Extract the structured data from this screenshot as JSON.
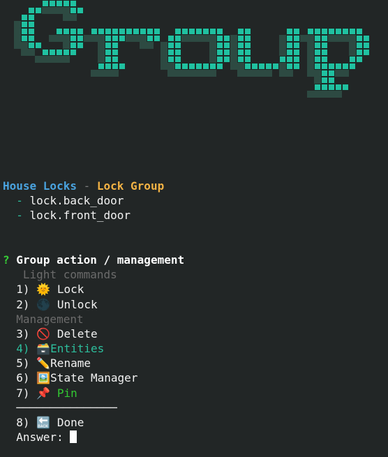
{
  "banner": {
    "text": "Group",
    "fill_color": "#20c1a1",
    "shadow_color": "#2d4a42",
    "grid_line_color": "#1c2a26"
  },
  "header": {
    "breadcrumb_parent": "House Locks",
    "breadcrumb_separator": " - ",
    "breadcrumb_current": "Lock Group",
    "members": [
      "lock.back_door",
      "lock.front_door"
    ],
    "member_bullet": "-"
  },
  "prompt": {
    "marker": "?",
    "question": "Group action / management",
    "sections": [
      {
        "heading": "Light commands",
        "options": [
          {
            "number": "1)",
            "icon": "sun-icon",
            "glyph": "🌞",
            "label": "Lock",
            "style": "normal"
          },
          {
            "number": "2)",
            "icon": "new-moon-icon",
            "glyph": "🌑",
            "label": "Unlock",
            "style": "normal"
          }
        ]
      },
      {
        "heading": "Management",
        "options": [
          {
            "number": "3)",
            "icon": "prohibited-icon",
            "glyph": "🚫",
            "label": "Delete",
            "style": "normal"
          },
          {
            "number": "4)",
            "icon": "card-file-box-icon",
            "glyph": "🗃️",
            "label": "Entities",
            "style": "selected"
          },
          {
            "number": "5)",
            "icon": "pencil-icon",
            "glyph": "✏️",
            "label": "Rename",
            "style": "normal"
          },
          {
            "number": "6)",
            "icon": "framed-picture-icon",
            "glyph": "🖼️",
            "label": "State Manager",
            "style": "normal"
          },
          {
            "number": "7)",
            "icon": "pushpin-icon",
            "glyph": "📌",
            "label": "Pin",
            "style": "accent"
          }
        ]
      }
    ],
    "separator": "───────────────",
    "done_option": {
      "number": "8)",
      "icon": "back-arrow-icon",
      "glyph": "🔙",
      "label": "Done"
    },
    "answer_label": "Answer:"
  },
  "colors": {
    "background": "#222626",
    "heading_blue": "#4aa3df",
    "heading_orange": "#f2b244",
    "selected_teal": "#2dbf9d",
    "accent_green": "#32c832",
    "question_marker_green": "#37d137",
    "section_gray": "#6b6b6b"
  }
}
